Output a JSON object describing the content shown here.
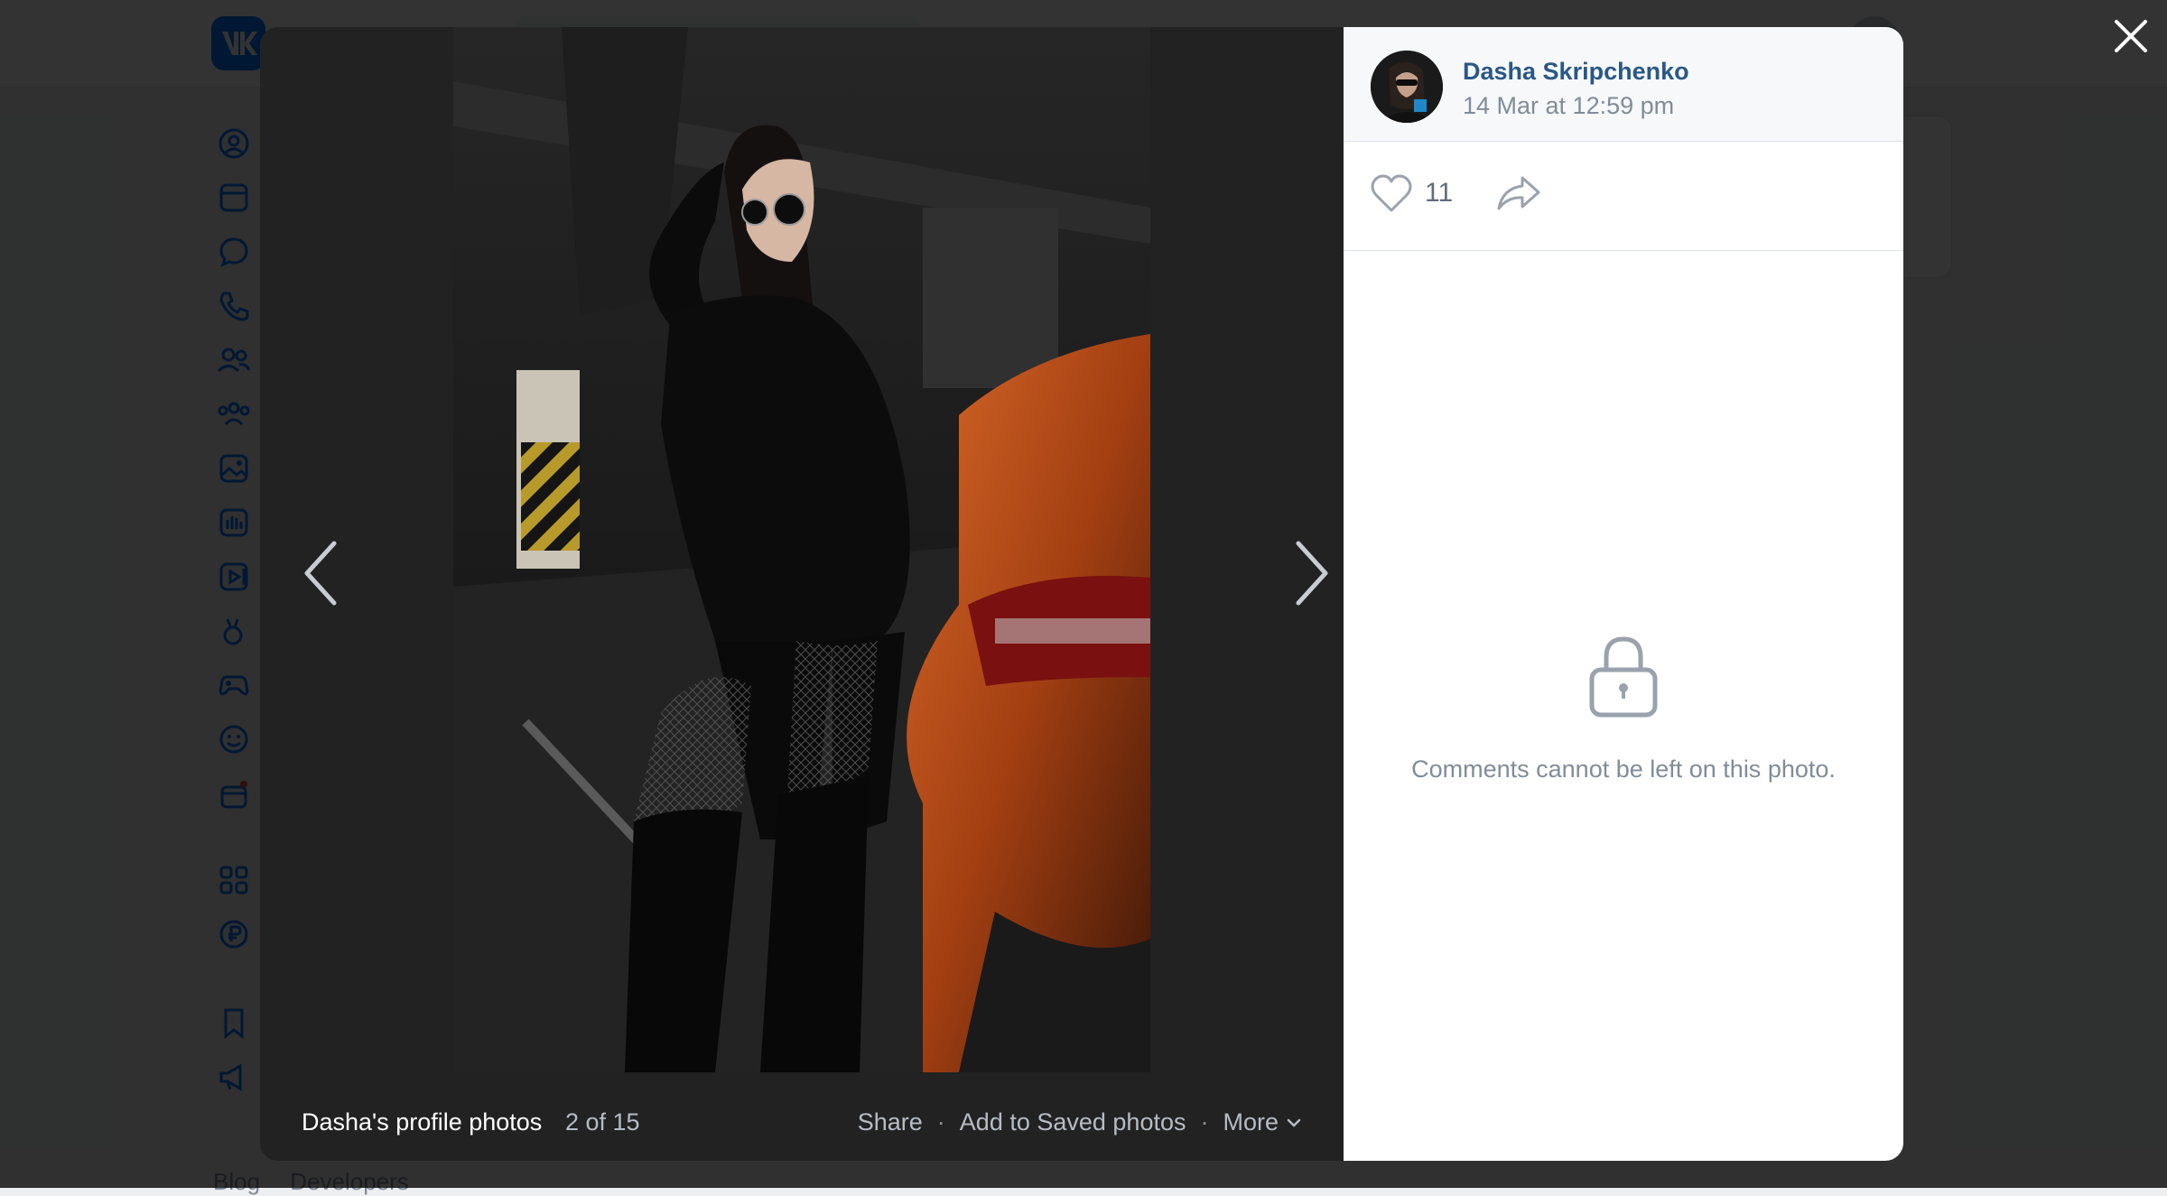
{
  "viewer": {
    "album_title": "Dasha's profile photos",
    "counter": "2 of 15",
    "actions": {
      "share": "Share",
      "save": "Add to Saved photos",
      "more": "More"
    }
  },
  "panel": {
    "author_name": "Dasha Skripchenko",
    "date": "14 Mar at 12:59 pm",
    "likes": "11",
    "comments_locked_text": "Comments cannot be left on this photo."
  },
  "background": {
    "footer_links": [
      "Blog",
      "Developers"
    ]
  },
  "colors": {
    "accent": "#0077ff",
    "link": "#2a5885",
    "secondary_text": "#818c99",
    "car_orange": "#c24e17"
  }
}
